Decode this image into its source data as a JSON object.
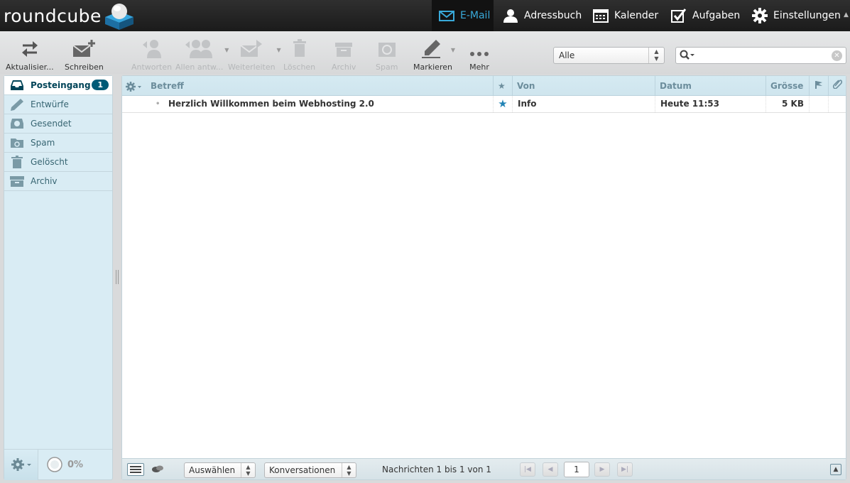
{
  "app": {
    "logo_text": "roundcube"
  },
  "nav": {
    "mail": "E-Mail",
    "addressbook": "Adressbuch",
    "calendar": "Kalender",
    "tasks": "Aufgaben",
    "settings": "Einstellungen"
  },
  "toolbar": {
    "refresh": "Aktualisier...",
    "compose": "Schreiben",
    "reply": "Antworten",
    "reply_all": "Allen antw...",
    "forward": "Weiterleiten",
    "delete": "Löschen",
    "archive": "Archiv",
    "spam": "Spam",
    "mark": "Markieren",
    "more": "Mehr"
  },
  "filter": {
    "selected": "Alle"
  },
  "search": {
    "value": ""
  },
  "folders": [
    {
      "label": "Posteingang",
      "unread": "1"
    },
    {
      "label": "Entwürfe"
    },
    {
      "label": "Gesendet"
    },
    {
      "label": "Spam"
    },
    {
      "label": "Gelöscht"
    },
    {
      "label": "Archiv"
    }
  ],
  "quota": "0%",
  "list": {
    "columns": {
      "subject": "Betreff",
      "from": "Von",
      "date": "Datum",
      "size": "Grösse"
    },
    "messages": [
      {
        "subject": "Herzlich Willkommen beim Webhosting 2.0",
        "from": "Info",
        "date": "Heute 11:53",
        "size": "5 KB",
        "flagged": true
      }
    ]
  },
  "footer": {
    "select": "Auswählen",
    "threads": "Konversationen",
    "count": "Nachrichten 1 bis 1 von 1",
    "page": "1"
  },
  "colors": {
    "accent": "#39a9d9",
    "badge": "#005a76",
    "sidebar_bg": "#d9ecf4"
  }
}
